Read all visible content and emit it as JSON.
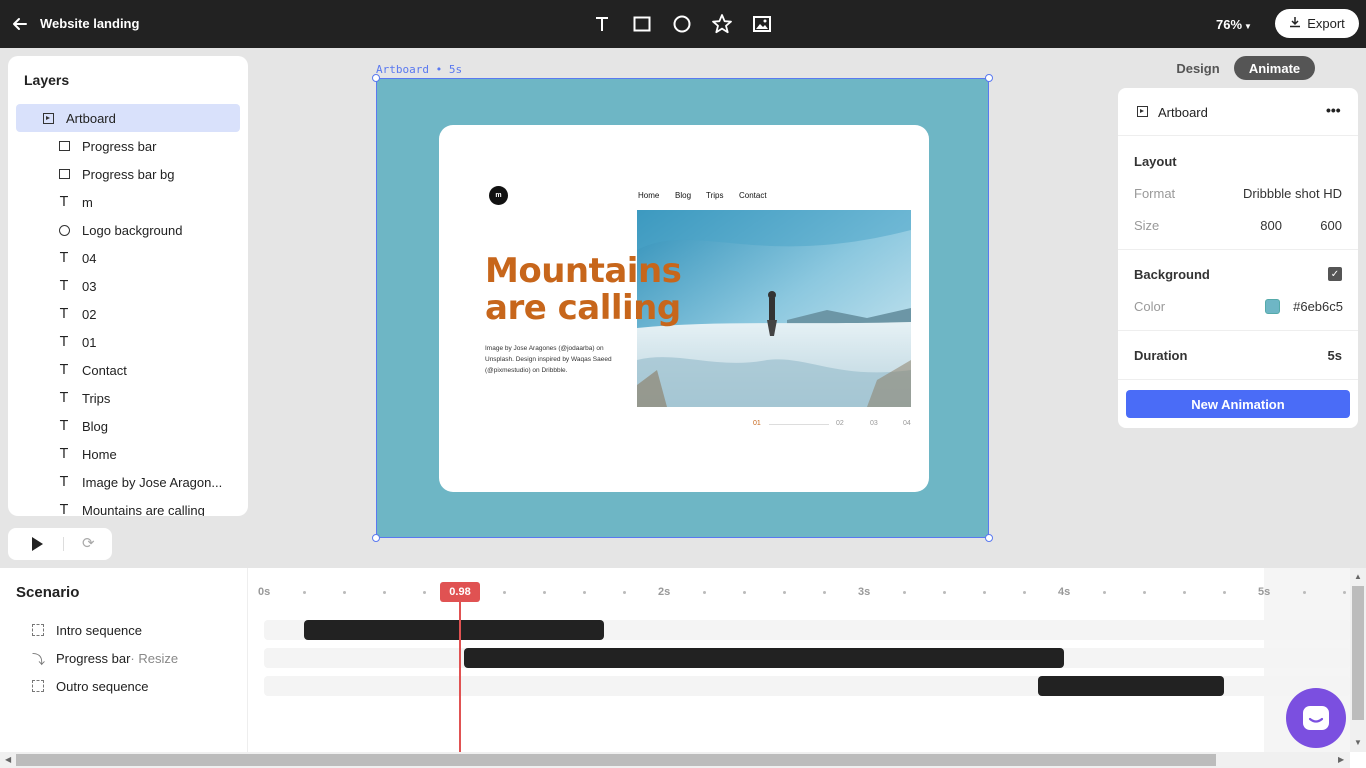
{
  "topbar": {
    "title": "Website landing",
    "zoom": "76%",
    "export_label": "Export",
    "tools": [
      "text-tool-icon",
      "rectangle-tool-icon",
      "ellipse-tool-icon",
      "star-tool-icon",
      "image-tool-icon"
    ]
  },
  "layers": {
    "title": "Layers",
    "items": [
      {
        "label": "Artboard",
        "type": "artboard",
        "selected": true
      },
      {
        "label": "Progress bar",
        "type": "rect"
      },
      {
        "label": "Progress bar bg",
        "type": "rect"
      },
      {
        "label": "m",
        "type": "text"
      },
      {
        "label": "Logo background",
        "type": "ellipse"
      },
      {
        "label": "04",
        "type": "text"
      },
      {
        "label": "03",
        "type": "text"
      },
      {
        "label": "02",
        "type": "text"
      },
      {
        "label": "01",
        "type": "text"
      },
      {
        "label": "Contact",
        "type": "text"
      },
      {
        "label": "Trips",
        "type": "text"
      },
      {
        "label": "Blog",
        "type": "text"
      },
      {
        "label": "Home",
        "type": "text"
      },
      {
        "label": "Image by Jose Aragon...",
        "type": "text"
      },
      {
        "label": "Mountains are calling",
        "type": "text"
      }
    ]
  },
  "canvas": {
    "board_label": "Artboard • 5s",
    "logo_letter": "m",
    "nav": [
      "Home",
      "Blog",
      "Trips",
      "Contact"
    ],
    "headline_line1": "Mountains",
    "headline_line2": "are calling",
    "caption": "Image by Jose Aragones (@jodaarba) on Unsplash. Design inspired by Waqas Saeed (@pixmestudio) on Dribbble.",
    "pages": [
      "01",
      "02",
      "03",
      "04"
    ],
    "artboard_color": "#6eb6c5",
    "accent_color": "#c7661b"
  },
  "mode_tabs": {
    "design": "Design",
    "animate": "Animate",
    "active": "Animate"
  },
  "props": {
    "title": "Artboard",
    "layout_title": "Layout",
    "format_label": "Format",
    "format_value": "Dribbble shot HD",
    "size_label": "Size",
    "width": "800",
    "height": "600",
    "background_title": "Background",
    "background_enabled": true,
    "color_label": "Color",
    "color_value": "#6eb6c5",
    "duration_title": "Duration",
    "duration_value": "5s",
    "new_animation": "New Animation"
  },
  "timeline": {
    "title": "Scenario",
    "ticks": [
      "0s",
      "2s",
      "3s",
      "4s",
      "5s"
    ],
    "playhead": "0.98",
    "items": [
      {
        "label": "Intro sequence",
        "sub": "",
        "icon": "dashed-square-icon",
        "start": 0.2,
        "end": 1.7
      },
      {
        "label": "Progress bar",
        "sub": " · Resize",
        "icon": "bolt-icon",
        "start": 1.0,
        "end": 4.0
      },
      {
        "label": "Outro sequence",
        "sub": "",
        "icon": "dashed-square-icon",
        "start": 3.87,
        "end": 4.8
      }
    ]
  }
}
